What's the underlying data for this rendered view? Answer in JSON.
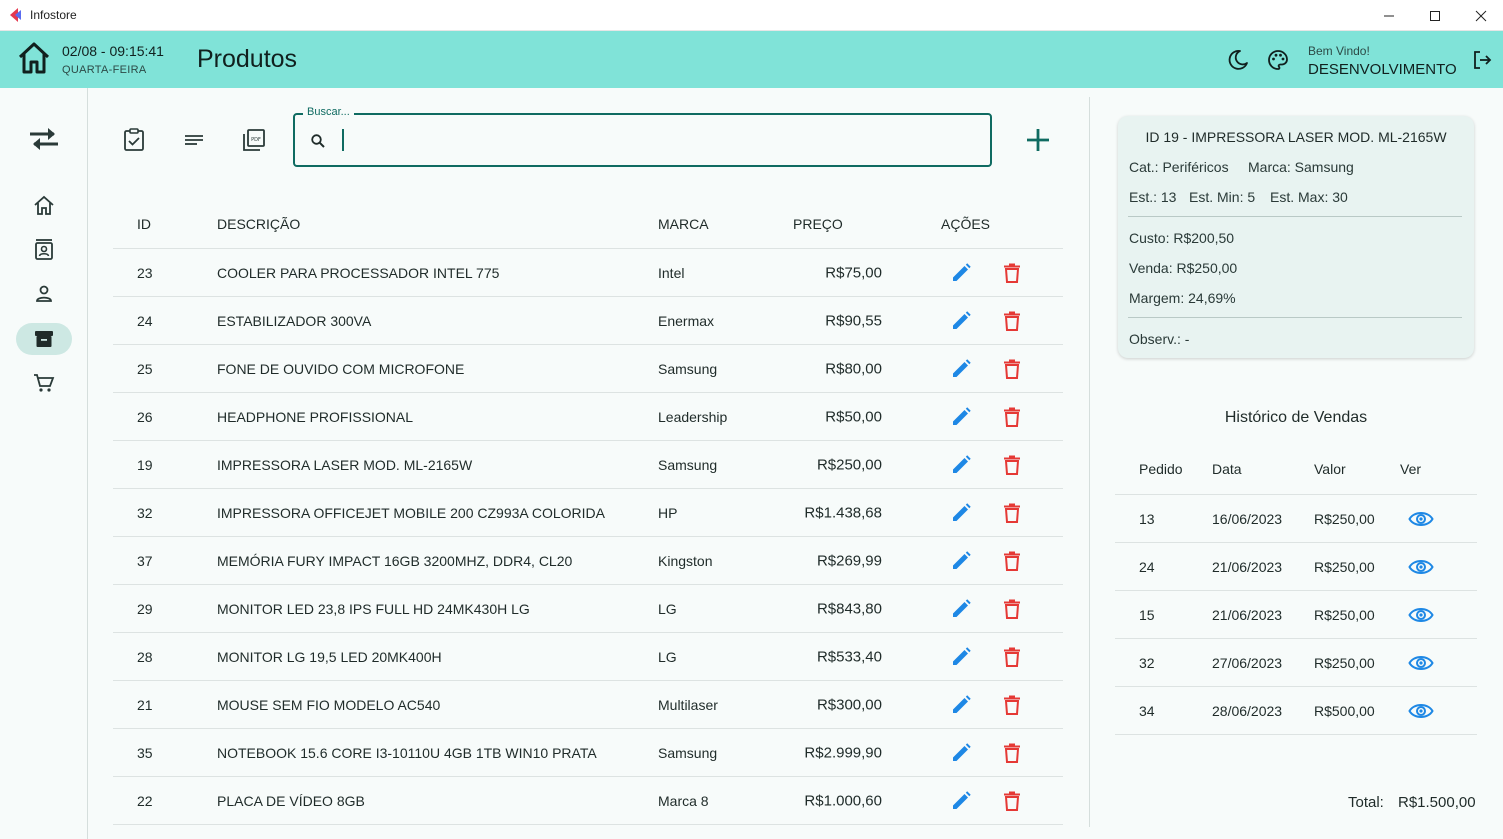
{
  "window": {
    "title": "Infostore"
  },
  "header": {
    "date_time": "02/08 - 09:15:41",
    "weekday": "QUARTA-FEIRA",
    "page_title": "Produtos",
    "welcome": "Bem Vindo!",
    "username": "DESENVOLVIMENTO"
  },
  "search": {
    "label": "Buscar...",
    "value": ""
  },
  "table": {
    "headers": {
      "id": "ID",
      "description": "DESCRIÇÃO",
      "brand": "MARCA",
      "price": "PREÇO",
      "actions": "AÇÕES"
    },
    "rows": [
      {
        "id": "23",
        "description": "COOLER PARA PROCESSADOR INTEL 775",
        "brand": "Intel",
        "price": "R$75,00"
      },
      {
        "id": "24",
        "description": "ESTABILIZADOR 300VA",
        "brand": "Enermax",
        "price": "R$90,55"
      },
      {
        "id": "25",
        "description": "FONE DE OUVIDO COM MICROFONE",
        "brand": "Samsung",
        "price": "R$80,00"
      },
      {
        "id": "26",
        "description": "HEADPHONE PROFISSIONAL",
        "brand": "Leadership",
        "price": "R$50,00"
      },
      {
        "id": "19",
        "description": "IMPRESSORA LASER MOD. ML-2165W",
        "brand": "Samsung",
        "price": "R$250,00"
      },
      {
        "id": "32",
        "description": "IMPRESSORA OFFICEJET MOBILE 200 CZ993A COLORIDA",
        "brand": "HP",
        "price": "R$1.438,68"
      },
      {
        "id": "37",
        "description": "MEMÓRIA FURY IMPACT 16GB 3200MHZ, DDR4, CL20",
        "brand": "Kingston",
        "price": "R$269,99"
      },
      {
        "id": "29",
        "description": "MONITOR LED 23,8 IPS FULL HD 24MK430H LG",
        "brand": "LG",
        "price": "R$843,80"
      },
      {
        "id": "28",
        "description": "MONITOR LG 19,5 LED 20MK400H",
        "brand": "LG",
        "price": "R$533,40"
      },
      {
        "id": "21",
        "description": "MOUSE SEM FIO MODELO AC540",
        "brand": "Multilaser",
        "price": "R$300,00"
      },
      {
        "id": "35",
        "description": "NOTEBOOK 15.6 CORE I3-10110U 4GB 1TB WIN10 PRATA",
        "brand": "Samsung",
        "price": "R$2.999,90"
      },
      {
        "id": "22",
        "description": "PLACA DE VÍDEO 8GB",
        "brand": "Marca 8",
        "price": "R$1.000,60"
      }
    ]
  },
  "detail": {
    "title": "ID 19 - IMPRESSORA LASER MOD. ML-2165W",
    "category": "Cat.: Periféricos",
    "brand": "Marca: Samsung",
    "stock": "Est.: 13",
    "stock_min": "Est. Min: 5",
    "stock_max": "Est. Max: 30",
    "cost": "Custo: R$200,50",
    "sale": "Venda: R$250,00",
    "margin": "Margem: 24,69%",
    "notes": "Observ.: -"
  },
  "history": {
    "title": "Histórico de Vendas",
    "headers": {
      "order": "Pedido",
      "date": "Data",
      "value": "Valor",
      "view": "Ver"
    },
    "rows": [
      {
        "order": "13",
        "date": "16/06/2023",
        "value": "R$250,00"
      },
      {
        "order": "24",
        "date": "21/06/2023",
        "value": "R$250,00"
      },
      {
        "order": "15",
        "date": "21/06/2023",
        "value": "R$250,00"
      },
      {
        "order": "32",
        "date": "27/06/2023",
        "value": "R$250,00"
      },
      {
        "order": "34",
        "date": "28/06/2023",
        "value": "R$500,00"
      }
    ],
    "total_label": "Total:",
    "total_value": "R$1.500,00"
  },
  "colors": {
    "header_bg": "#80e3d8",
    "accent": "#0f6b61",
    "edit_blue": "#1e88e5",
    "delete_red": "#e53935",
    "nav_active_bg": "#cde8e3"
  },
  "icons": {
    "nav": [
      "swap-icon",
      "home-icon",
      "contacts-icon",
      "person-icon",
      "inventory-icon",
      "cart-icon"
    ],
    "toolbar": [
      "clipboard-check-icon",
      "sort-lines-icon",
      "pdf-icon"
    ],
    "row_actions": [
      "edit-pencil-icon",
      "delete-trash-icon"
    ],
    "history_action": "eye-icon"
  }
}
